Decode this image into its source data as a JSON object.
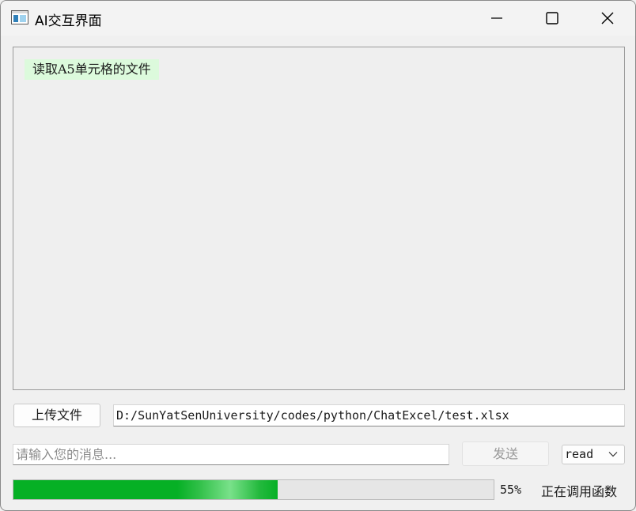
{
  "window": {
    "title": "AI交互界面",
    "icons": {
      "app": "app-window-icon",
      "minimize": "minimize-icon",
      "maximize": "maximize-icon",
      "close": "close-icon"
    }
  },
  "chat": {
    "messages": [
      {
        "text": "读取A5单元格的文件",
        "bubble_color": "#dcfadc"
      }
    ]
  },
  "upload": {
    "button_label": "上传文件",
    "file_path": "D:/SunYatSenUniversity/codes/python/ChatExcel/test.xlsx"
  },
  "message": {
    "input_value": "",
    "input_placeholder": "请输入您的消息...",
    "send_label": "发送",
    "mode_selected": "read",
    "mode_icon": "chevron-down-icon"
  },
  "progress": {
    "value": 0.55,
    "percent_text": "55%",
    "status_text": "正在调用函数",
    "fill_color": "#06b025"
  }
}
